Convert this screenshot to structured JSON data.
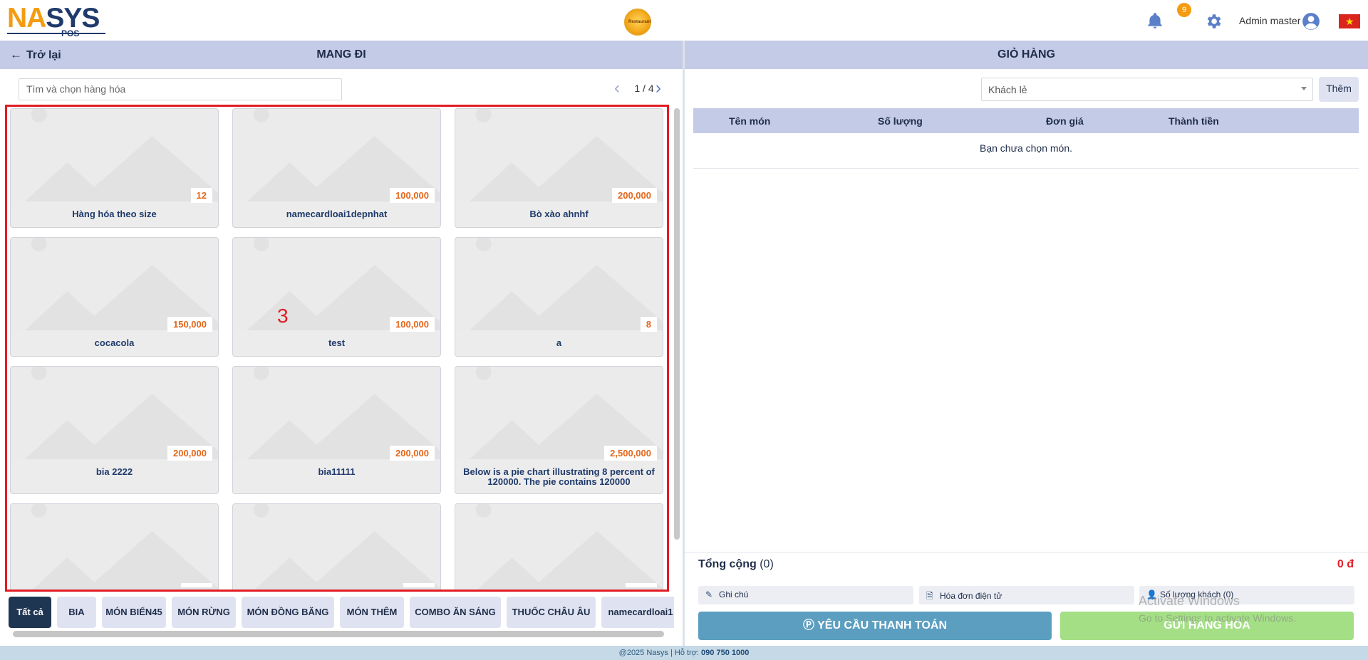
{
  "header": {
    "logo_text_na": "NA",
    "logo_text_s": "S",
    "logo_text_ys": "YS",
    "logo_sub": "POS",
    "center_logo_text": "Restaurant",
    "notification_count": "9",
    "username": "Admin master",
    "flag": "★"
  },
  "left": {
    "back_label": "Trở lại",
    "title": "MANG ĐI",
    "search_placeholder": "Tìm và chọn hàng hóa",
    "pager_text": "1 / 4",
    "annotation": "3",
    "products": [
      {
        "name": "Hàng hóa theo size",
        "price": "12"
      },
      {
        "name": "namecardloai1depnhat",
        "price": "100,000"
      },
      {
        "name": "Bò xào ahnhf",
        "price": "200,000"
      },
      {
        "name": "cocacola",
        "price": "150,000"
      },
      {
        "name": "test",
        "price": "100,000"
      },
      {
        "name": "a",
        "price": "8"
      },
      {
        "name": "bia 2222",
        "price": "200,000"
      },
      {
        "name": "bia11111",
        "price": "200,000"
      },
      {
        "name": "Below is a pie chart illustrating 8 percent of 120000. The pie contains 120000",
        "price": "2,500,000"
      },
      {
        "name": "",
        "price": ""
      },
      {
        "name": "",
        "price": ""
      },
      {
        "name": "",
        "price": ""
      }
    ],
    "categories": [
      "Tất cả",
      "BIA",
      "MÓN BIỂN45",
      "MÓN RỪNG",
      "MÓN ĐỒNG BĂNG",
      "MÓN THÊM",
      "COMBO ĂN SÁNG",
      "THUỐC CHÂU ÂU",
      "namecardloai1"
    ]
  },
  "right": {
    "title": "GIỎ HÀNG",
    "customer": "Khách lẻ",
    "add_label": "Thêm",
    "columns": [
      "Tên món",
      "Số lượng",
      "Đơn giá",
      "Thành tiền"
    ],
    "empty_text": "Bạn chưa chọn món.",
    "total_label": "Tổng cộng",
    "total_count": "(0)",
    "total_value": "0 đ",
    "note_label": "Ghi chú",
    "einvoice_label": "Hóa đơn điện tử",
    "guests_label": "Số lượng khách (0)",
    "pay_label": "YÊU CẦU THANH TOÁN",
    "send_label": "GỬI HÀNG HÓA"
  },
  "watermark": {
    "line1": "Activate Windows",
    "line2": "Go to Settings to activate Windows."
  },
  "footer": {
    "text": "@2025 Nasys | Hỗ trợ: ",
    "phone": "090 750 1000"
  },
  "colors": {
    "accent": "#1f3652",
    "header_bg": "#c3cbe6",
    "price": "#e4661a",
    "highlight": "#e21c24"
  }
}
